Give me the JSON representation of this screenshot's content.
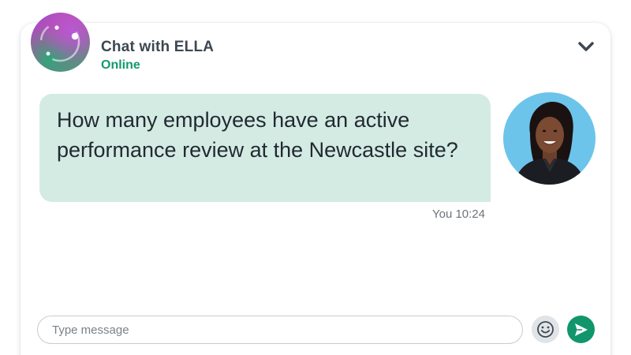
{
  "header": {
    "title": "Chat with ELLA",
    "status": "Online",
    "collapse_icon": "chevron-down-icon",
    "bot_avatar_icon": "ella-logo-icon",
    "status_color": "#119a6d"
  },
  "messages": [
    {
      "text": "How many employees have an active performance review at the Newcastle site?",
      "sender": "You",
      "time": "10:24",
      "meta": "You 10:24",
      "bubble_color": "#d4ebe4"
    }
  ],
  "composer": {
    "placeholder": "Type message",
    "value": "",
    "emoji_icon": "smiley-icon",
    "send_icon": "send-arrow-icon",
    "send_color": "#11966c"
  }
}
